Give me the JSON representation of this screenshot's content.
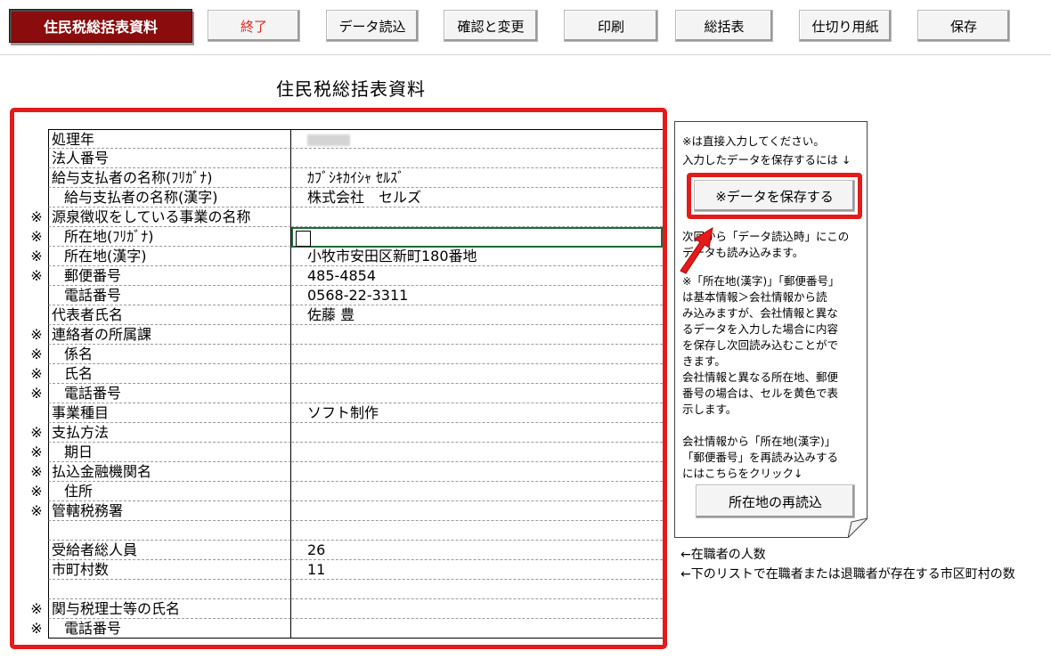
{
  "toolbar": {
    "title": "住民税総括表資料",
    "buttons": [
      "終了",
      "データ読込",
      "確認と変更",
      "印刷",
      "総括表",
      "仕切り用紙",
      "保存"
    ]
  },
  "page_title": "住民税総括表資料",
  "form": {
    "rows": [
      {
        "mark": "",
        "label": "処理年",
        "value": "",
        "indent": 0
      },
      {
        "mark": "",
        "label": "法人番号",
        "value": "",
        "indent": 0
      },
      {
        "mark": "",
        "label": "給与支払者の名称(ﾌﾘｶﾞﾅ)",
        "value": "ｶﾌﾞｼｷｶｲｼｬ ｾﾙｽﾞ",
        "indent": 0
      },
      {
        "mark": "",
        "label": "給与支払者の名称(漢字)",
        "value": "株式会社　セルズ",
        "indent": 1
      },
      {
        "mark": "※",
        "label": "源泉徴収をしている事業の名称",
        "value": "",
        "indent": 0
      },
      {
        "mark": "※",
        "label": "所在地(ﾌﾘｶﾞﾅ)",
        "value": "",
        "indent": 1
      },
      {
        "mark": "※",
        "label": "所在地(漢字)",
        "value": "小牧市安田区新町180番地",
        "indent": 1
      },
      {
        "mark": "※",
        "label": "郵便番号",
        "value": "485-4854",
        "indent": 1
      },
      {
        "mark": "",
        "label": "電話番号",
        "value": "0568-22-3311",
        "indent": 1
      },
      {
        "mark": "",
        "label": "代表者氏名",
        "value": "佐藤 豊",
        "indent": 0
      },
      {
        "mark": "※",
        "label": "連絡者の所属課",
        "value": "",
        "indent": 0
      },
      {
        "mark": "※",
        "label": "係名",
        "value": "",
        "indent": 1
      },
      {
        "mark": "※",
        "label": "氏名",
        "value": "",
        "indent": 1
      },
      {
        "mark": "※",
        "label": "電話番号",
        "value": "",
        "indent": 1
      },
      {
        "mark": "",
        "label": "事業種目",
        "value": "ソフト制作",
        "indent": 0
      },
      {
        "mark": "※",
        "label": "支払方法",
        "value": "",
        "indent": 0
      },
      {
        "mark": "※",
        "label": "期日",
        "value": "",
        "indent": 1
      },
      {
        "mark": "※",
        "label": "払込金融機関名",
        "value": "",
        "indent": 0
      },
      {
        "mark": "※",
        "label": "住所",
        "value": "",
        "indent": 1
      },
      {
        "mark": "※",
        "label": "管轄税務署",
        "value": "",
        "indent": 0
      },
      {
        "mark": "",
        "label": "",
        "value": "",
        "indent": 0
      },
      {
        "mark": "",
        "label": "受給者総人員",
        "value": "26",
        "indent": 0
      },
      {
        "mark": "",
        "label": "市町村数",
        "value": "11",
        "indent": 0
      },
      {
        "mark": "",
        "label": "",
        "value": "",
        "indent": 0
      },
      {
        "mark": "※",
        "label": "関与税理士等の氏名",
        "value": "",
        "indent": 0
      },
      {
        "mark": "※",
        "label": "電話番号",
        "value": "",
        "indent": 1
      }
    ]
  },
  "note": {
    "line1": "※は直接入力してください。",
    "line2": "入力したデータを保存するには ↓",
    "save_button": "※データを保存する",
    "para1": "次回から「データ読込時」にこの\nデータも読み込みます。",
    "para2": "※「所在地(漢字)」「郵便番号」\nは基本情報＞会社情報から読\nみ込みますが、会社情報と異な\nるデータを入力した場合に内容\nを保存し次回読み込むことがで\nきます。\n会社情報と異なる所在地、郵便\n番号の場合は、セルを黄色で表\n示します。",
    "para3": "会社情報から「所在地(漢字)」\n「郵便番号」を再読み込みする\nにはこちらをクリック↓",
    "reload_button": "所在地の再読込"
  },
  "side_notes": {
    "employees": "←在職者の人数",
    "municipalities": "←下のリストで在職者または退職者が存在する市区町村の数"
  },
  "colors": {
    "title_bg": "#8b0c0c",
    "highlight": "#e31b1b",
    "end_text": "#e0281c"
  }
}
